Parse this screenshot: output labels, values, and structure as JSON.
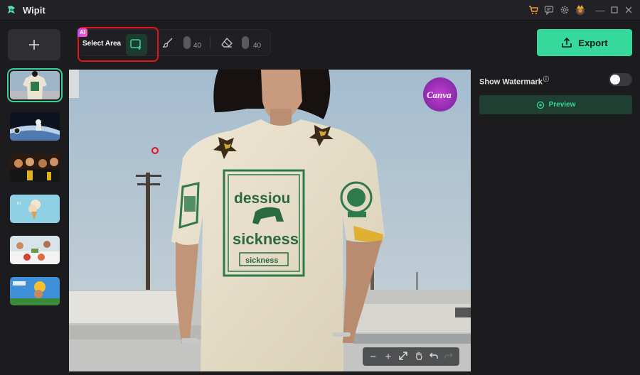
{
  "app": {
    "title": "Wipit"
  },
  "toolbar": {
    "ai_badge": "AI",
    "select_area_label": "Select Area",
    "brush_size": "40",
    "eraser_size": "40",
    "export_label": "Export"
  },
  "right_panel": {
    "watermark_label": "Show Watermark",
    "watermark_info": "ⓘ",
    "watermark_enabled": false,
    "preview_label": "Preview"
  },
  "canvas": {
    "watermark_logo_text": "Canva",
    "shirt_print_line1": "dessiou",
    "shirt_print_line2": "sickness",
    "shirt_print_line3": "sickness"
  },
  "thumbnails": [
    {
      "name": "tshirt-photo",
      "selected": true
    },
    {
      "name": "astronaut-photo",
      "selected": false
    },
    {
      "name": "graduation-photo",
      "selected": false
    },
    {
      "name": "icecream-photo",
      "selected": false
    },
    {
      "name": "dining-photo",
      "selected": false
    },
    {
      "name": "wipit-promo-photo",
      "selected": false
    }
  ],
  "colors": {
    "accent": "#35d99c",
    "highlight_box": "#e3141b",
    "background": "#1c1c1e"
  }
}
